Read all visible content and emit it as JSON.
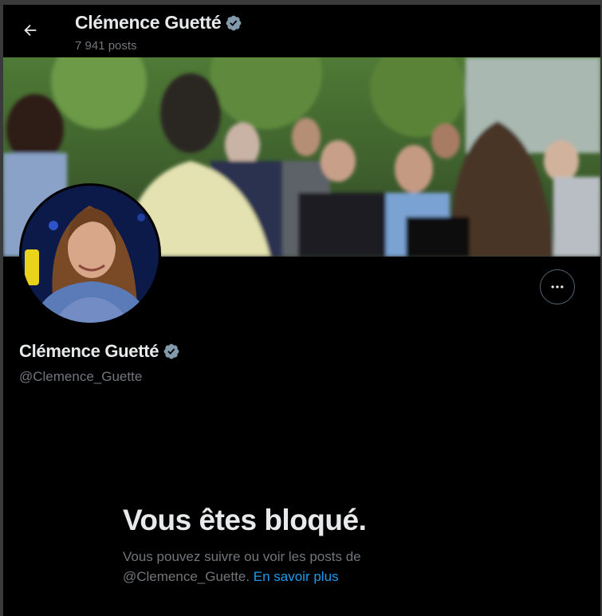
{
  "header": {
    "back_label": "Retour",
    "name": "Clémence Guetté",
    "post_count": "7 941 posts"
  },
  "profile": {
    "name": "Clémence Guetté",
    "handle": "@Clemence_Guette"
  },
  "blocked": {
    "title": "Vous êtes bloqué.",
    "description_prefix": "Vous pouvez suivre ou voir les posts de",
    "description_handle": "@Clemence_Guette.",
    "learn_more": "En savoir plus"
  },
  "colors": {
    "background": "#000000",
    "text_primary": "#e7e9ea",
    "text_secondary": "#71767b",
    "link": "#1d9bf0",
    "verified_badge": "#829aab"
  },
  "icons": {
    "back": "arrow-left-icon",
    "verified": "verified-badge-icon",
    "more": "more-options-icon"
  }
}
